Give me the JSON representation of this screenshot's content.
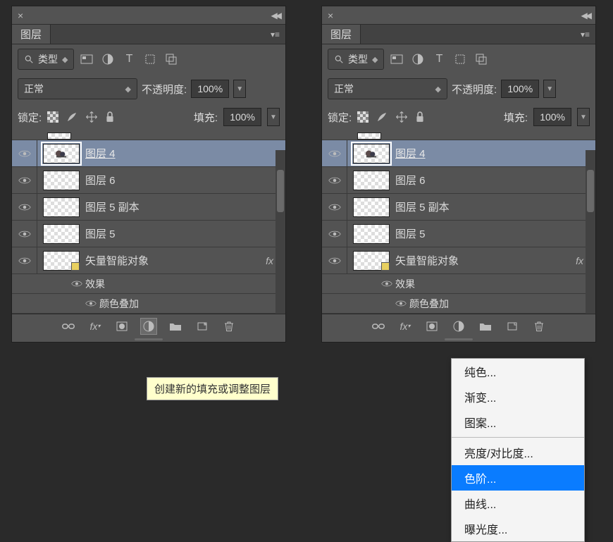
{
  "panel_tab": "图层",
  "filter": {
    "label": "类型",
    "search_icon": "search"
  },
  "blend": {
    "mode": "正常",
    "opacity_label": "不透明度:",
    "opacity_value": "100%"
  },
  "lock": {
    "label": "锁定:",
    "fill_label": "填充:",
    "fill_value": "100%"
  },
  "truncated_layer_hint": "···",
  "layers": [
    {
      "name": "图层 4",
      "selected": true,
      "motif": true
    },
    {
      "name": "图层 6"
    },
    {
      "name": "图层 5 副本"
    },
    {
      "name": "图层 5"
    },
    {
      "name": "矢量智能对象",
      "smart": true,
      "fx": true,
      "effects_label": "效果",
      "effects": [
        "颜色叠加"
      ]
    }
  ],
  "tooltip": "创建新的填充或调整图层",
  "context_menu": {
    "g1": [
      "纯色...",
      "渐变...",
      "图案..."
    ],
    "g2": [
      "亮度/对比度...",
      "色阶...",
      "曲线...",
      "曝光度..."
    ],
    "selected": "色阶..."
  }
}
